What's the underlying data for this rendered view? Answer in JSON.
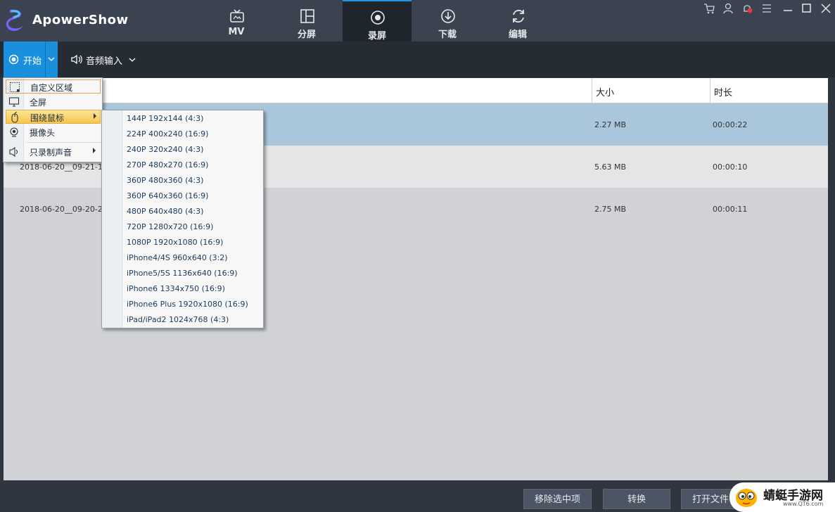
{
  "app": {
    "name": "ApowerShow"
  },
  "tabs": [
    {
      "label": "MV",
      "icon": "tv-icon"
    },
    {
      "label": "分屏",
      "icon": "split-screen-icon"
    },
    {
      "label": "录屏",
      "icon": "record-icon",
      "active": true
    },
    {
      "label": "下载",
      "icon": "download-icon"
    },
    {
      "label": "编辑",
      "icon": "refresh-icon"
    }
  ],
  "window_controls": [
    "cart-icon",
    "user-icon",
    "notification-icon",
    "menu-icon",
    "minimize-icon",
    "maximize-icon",
    "close-icon"
  ],
  "toolbar": {
    "start_label": "开始",
    "audio_label": "音频输入"
  },
  "table": {
    "headers": {
      "size": "大小",
      "duration": "时长"
    },
    "rows": [
      {
        "name": "",
        "size": "2.27 MB",
        "duration": "00:00:22",
        "selected": true
      },
      {
        "name": "2018-06-20__09-21-15_",
        "size": "5.63 MB",
        "duration": "00:00:10"
      },
      {
        "name": "2018-06-20__09-20-24_",
        "size": "2.75 MB",
        "duration": "00:00:11"
      }
    ]
  },
  "record_menu": {
    "items": [
      {
        "label": "自定义区域",
        "icon": "region-select-icon"
      },
      {
        "label": "全屏",
        "icon": "monitor-icon"
      },
      {
        "label": "围绕鼠标",
        "icon": "mouse-icon",
        "has_submenu": true
      },
      {
        "label": "摄像头",
        "icon": "webcam-icon"
      },
      {
        "label": "只录制声音",
        "icon": "speaker-icon",
        "has_submenu": true
      }
    ]
  },
  "resolution_menu": {
    "items": [
      "144P 192x144 (4:3)",
      "224P 400x240 (16:9)",
      "240P 320x240 (4:3)",
      "270P 480x270 (16:9)",
      "360P 480x360 (4:3)",
      "360P 640x360 (16:9)",
      "480P 640x480 (4:3)",
      "720P 1280x720 (16:9)",
      "1080P 1920x1080 (16:9)",
      "iPhone4/4S 960x640 (3:2)",
      "iPhone5/5S 1136x640 (16:9)",
      "iPhone6 1334x750 (16:9)",
      "iPhone6 Plus 1920x1080 (16:9)",
      "iPad/iPad2 1024x768 (4:3)"
    ]
  },
  "bottom_buttons": {
    "remove": "移除选中项",
    "convert": "转换",
    "open_folder": "打开文件"
  },
  "watermark": {
    "text": "蜻蜓手游网",
    "sub": "www.QT6.com"
  },
  "colors": {
    "accent": "#1a8fdd",
    "titlebar": "#3b4350",
    "selected_row": "#a9c6da"
  }
}
